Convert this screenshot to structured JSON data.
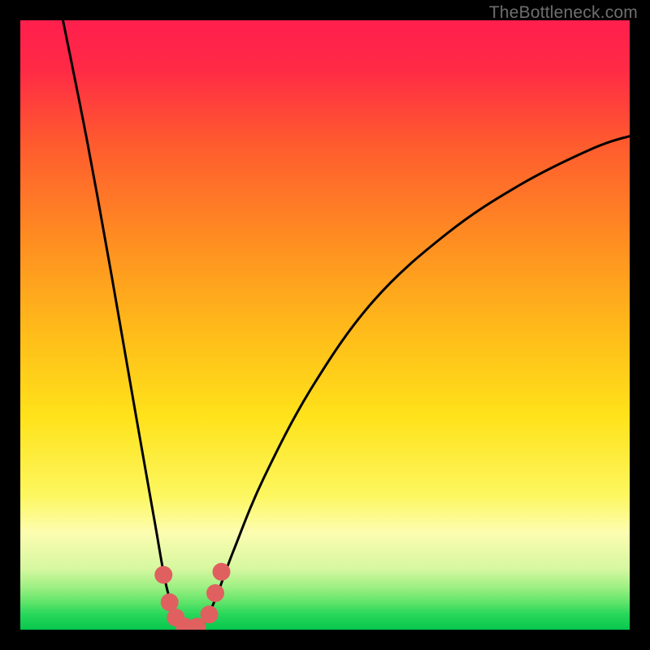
{
  "watermark": "TheBottleneck.com",
  "chart_data": {
    "type": "line",
    "title": "",
    "xlabel": "",
    "ylabel": "",
    "xlim": [
      0,
      100
    ],
    "ylim": [
      0,
      100
    ],
    "x_optimum": 27,
    "series": [
      {
        "name": "curve",
        "points": [
          {
            "x": 7,
            "y": 100
          },
          {
            "x": 11,
            "y": 80
          },
          {
            "x": 15,
            "y": 58
          },
          {
            "x": 19,
            "y": 35
          },
          {
            "x": 22,
            "y": 18
          },
          {
            "x": 24,
            "y": 7
          },
          {
            "x": 26,
            "y": 1
          },
          {
            "x": 28,
            "y": 0
          },
          {
            "x": 30,
            "y": 1
          },
          {
            "x": 32,
            "y": 5
          },
          {
            "x": 35,
            "y": 13
          },
          {
            "x": 40,
            "y": 25
          },
          {
            "x": 48,
            "y": 40
          },
          {
            "x": 58,
            "y": 54
          },
          {
            "x": 70,
            "y": 65
          },
          {
            "x": 82,
            "y": 73
          },
          {
            "x": 94,
            "y": 79
          },
          {
            "x": 100,
            "y": 81
          }
        ]
      }
    ],
    "markers": [
      {
        "x": 23.5,
        "y": 9.0
      },
      {
        "x": 24.5,
        "y": 4.5
      },
      {
        "x": 25.5,
        "y": 2.0
      },
      {
        "x": 27.0,
        "y": 0.5
      },
      {
        "x": 29.0,
        "y": 0.5
      },
      {
        "x": 31.0,
        "y": 2.5
      },
      {
        "x": 32.0,
        "y": 6.0
      },
      {
        "x": 33.0,
        "y": 9.5
      }
    ],
    "gradient_stops": [
      {
        "offset": 0.0,
        "color": "#ff1f4d"
      },
      {
        "offset": 0.08,
        "color": "#ff2a46"
      },
      {
        "offset": 0.2,
        "color": "#ff5a2f"
      },
      {
        "offset": 0.35,
        "color": "#ff8a22"
      },
      {
        "offset": 0.5,
        "color": "#ffb81a"
      },
      {
        "offset": 0.65,
        "color": "#ffe21a"
      },
      {
        "offset": 0.78,
        "color": "#fdf760"
      },
      {
        "offset": 0.84,
        "color": "#fdfdb0"
      },
      {
        "offset": 0.9,
        "color": "#d6f7a0"
      },
      {
        "offset": 0.93,
        "color": "#9ef083"
      },
      {
        "offset": 0.955,
        "color": "#5fe469"
      },
      {
        "offset": 0.975,
        "color": "#27d75a"
      },
      {
        "offset": 1.0,
        "color": "#08c74e"
      }
    ],
    "marker_color": "#e06060",
    "curve_color": "#000000"
  }
}
